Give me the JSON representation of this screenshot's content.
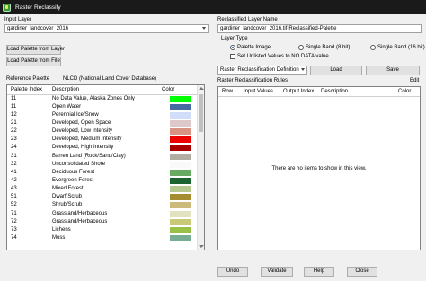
{
  "window": {
    "title": "Raster Reclassify"
  },
  "input_layer": {
    "label": "Input Layer",
    "value": "gardiner_landcover_2016"
  },
  "buttons": {
    "load_palette_from_layer": "Load Palette from Layer",
    "load_palette_from_file": "Load Palette from File"
  },
  "reference_palette": {
    "label": "Reference Palette",
    "palette_name": "NLCD (National Land Cover Database)",
    "columns": [
      "Palette Index",
      "Description",
      "Color"
    ],
    "rows": [
      {
        "index": "11",
        "description": "No Data Value, Alaska Zones Only",
        "color": "#00ff00"
      },
      {
        "index": "11",
        "description": "Open Water",
        "color": "#476ba0"
      },
      {
        "index": "12",
        "description": "Perennial Ice/Snow",
        "color": "#d1ddf9"
      },
      {
        "index": "21",
        "description": "Developed, Open Space",
        "color": "#ddc9c9"
      },
      {
        "index": "22",
        "description": "Developed, Low Intensity",
        "color": "#d89382"
      },
      {
        "index": "23",
        "description": "Developed, Medium Intensity",
        "color": "#ed0000"
      },
      {
        "index": "24",
        "description": "Developed, High Intensity",
        "color": "#aa0000"
      },
      {
        "index": "31",
        "description": "Barren Land (Rock/Sand/Clay)",
        "color": "#b2ada3"
      },
      {
        "index": "32",
        "description": "Unconsolidated Shore",
        "color": "#f9f9f9"
      },
      {
        "index": "41",
        "description": "Deciduous Forest",
        "color": "#68aa63"
      },
      {
        "index": "42",
        "description": "Evergreen Forest",
        "color": "#1c6330"
      },
      {
        "index": "43",
        "description": "Mixed Forest",
        "color": "#b5c98e"
      },
      {
        "index": "51",
        "description": "Dwarf Scrub",
        "color": "#a58c30"
      },
      {
        "index": "52",
        "description": "Shrub/Scrub",
        "color": "#ccba7c"
      },
      {
        "index": "71",
        "description": "Grassland/Herbaceous",
        "color": "#e2e2c1"
      },
      {
        "index": "72",
        "description": "Grassland/Herbaceous",
        "color": "#c9c977"
      },
      {
        "index": "73",
        "description": "Lichens",
        "color": "#99c147"
      },
      {
        "index": "74",
        "description": "Moss",
        "color": "#77ad93"
      }
    ]
  },
  "reclassified_layer": {
    "label": "Reclassified Layer Name",
    "value": "gardiner_landcover_2016.tif-Reclassified-Palette"
  },
  "layer_type": {
    "label": "Layer Type",
    "options": [
      "Palette Image",
      "Single Band (8 bit)",
      "Single Band (16 bit)"
    ],
    "selected": "Palette Image",
    "unlisted_label": "Set Unlisted Values to NO DATA value"
  },
  "definition": {
    "value": "Raster Reclassification Definition",
    "load_label": "Load",
    "save_label": "Save"
  },
  "rules": {
    "label": "Raster Reclassification Rules",
    "edit_label": "Edit",
    "columns": [
      "Row",
      "Input Values",
      "Output Index",
      "Description",
      "Color"
    ],
    "empty_text": "There are no items to show in this view."
  },
  "footer": {
    "undo": "Undo",
    "validate": "Validate",
    "help": "Help",
    "close": "Close"
  }
}
